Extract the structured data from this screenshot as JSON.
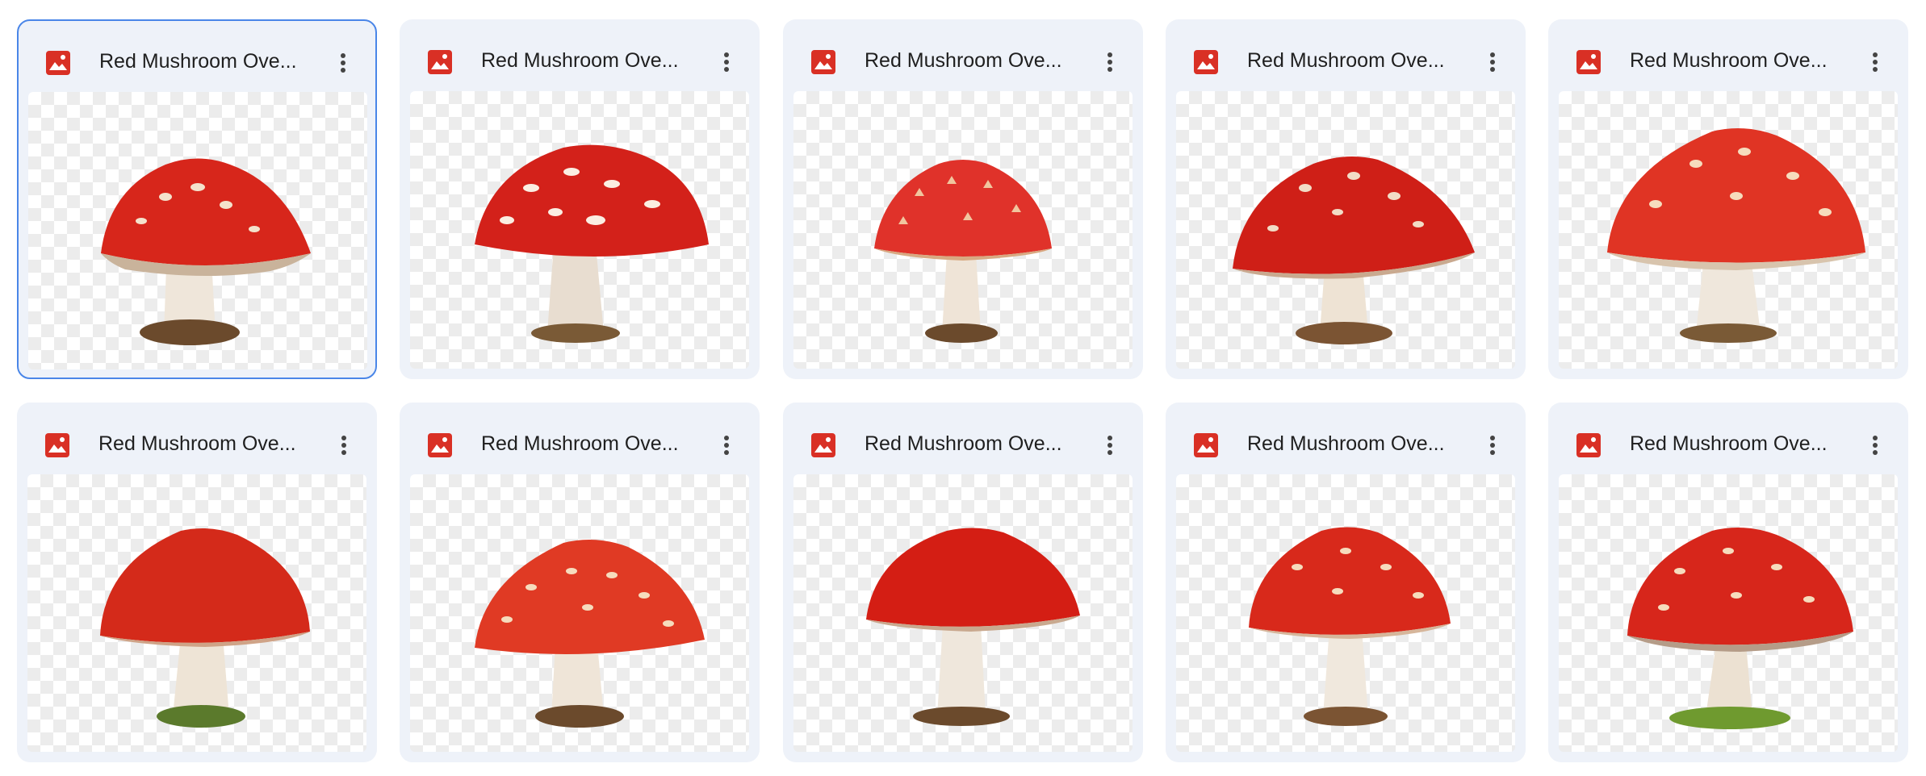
{
  "files": [
    {
      "name": "Red Mushroom Ove...",
      "icon": "image-file-icon",
      "selected": true
    },
    {
      "name": "Red Mushroom Ove...",
      "icon": "image-file-icon",
      "selected": false
    },
    {
      "name": "Red Mushroom Ove...",
      "icon": "image-file-icon",
      "selected": false
    },
    {
      "name": "Red Mushroom Ove...",
      "icon": "image-file-icon",
      "selected": false
    },
    {
      "name": "Red Mushroom Ove...",
      "icon": "image-file-icon",
      "selected": false
    },
    {
      "name": "Red Mushroom Ove...",
      "icon": "image-file-icon",
      "selected": false
    },
    {
      "name": "Red Mushroom Ove...",
      "icon": "image-file-icon",
      "selected": false
    },
    {
      "name": "Red Mushroom Ove...",
      "icon": "image-file-icon",
      "selected": false
    },
    {
      "name": "Red Mushroom Ove...",
      "icon": "image-file-icon",
      "selected": false
    },
    {
      "name": "Red Mushroom Ove...",
      "icon": "image-file-icon",
      "selected": false
    }
  ],
  "more_icon": "more-vertical-icon",
  "colors": {
    "accent_selected_border": "#4a86e8",
    "card_background": "#eef2f9",
    "image_icon_red": "#d93025",
    "text": "#1f1f1f"
  }
}
